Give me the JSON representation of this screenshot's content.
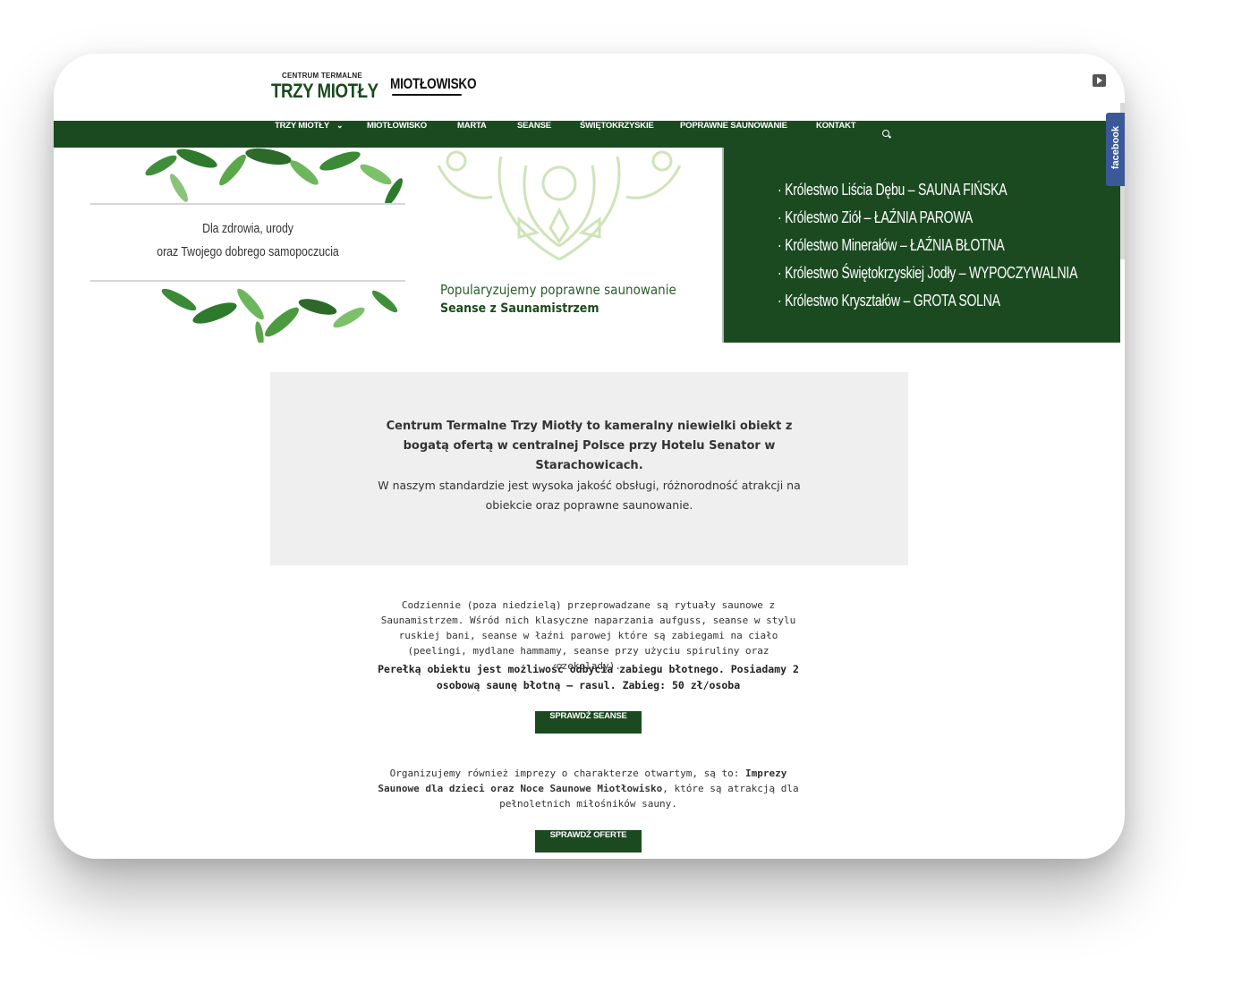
{
  "header": {
    "logo_small": "CENTRUM TERMALNE",
    "logo_big": "TRZY MIOTŁY",
    "logo_second": "MIOTŁOWISKO",
    "video_icon": "play-icon"
  },
  "nav": {
    "items": [
      "TRZY MIOTŁY",
      "MIOTŁOWISKO",
      "MARTA",
      "SEANSE",
      "ŚWIĘTOKRZYSKIE",
      "POPRAWNE SAUNOWANIE",
      "KONTAKT"
    ],
    "dropdown_icon": "chevron-down-icon",
    "search_icon": "search-icon",
    "bg_color": "#1b4a20"
  },
  "facebook_tab": {
    "label": "facebook",
    "color": "#3b5998"
  },
  "banner": {
    "card_line1": "Dla zdrowia, urody",
    "card_line2": "oraz Twojego dobrego samopoczucia",
    "tagline1": "Popularyzujemy poprawne saunowanie",
    "tagline2": "Seanse z Saunamistrzem",
    "kingdoms": [
      "· Królestwo Liścia Dębu – SAUNA FIŃSKA",
      "· Królestwo Ziół – ŁAŹNIA PAROWA",
      "· Królestwo Minerałów – ŁAŹNIA BŁOTNA",
      "· Królestwo Świętokrzyskiej Jodły – WYPOCZYWALNIA",
      "· Królestwo Kryształów – GROTA SOLNA"
    ]
  },
  "intro": {
    "bold": "Centrum Termalne Trzy Miotły to kameralny niewielki obiekt z bogatą ofertą w centralnej Polsce przy Hotelu Senator w Starachowicach.",
    "normal": "W naszym standardzie jest wysoka jakość obsługi, różnorodność atrakcji na obiekcie oraz poprawne saunowanie."
  },
  "rituals": {
    "text": "Codziennie (poza niedzielą) przeprowadzane są rytuały saunowe z Saunamistrzem. Wśród nich klasyczne naparzania aufguss, seanse w stylu ruskiej bani, seanse w łaźni parowej które są zabiegami na ciało (peelingi, mydlane hammamy, seanse przy użyciu spiruliny oraz czekolady).",
    "bold": "Perełką obiektu jest możliwość odbycia zabiegu błotnego. Posiadamy 2 osobową saunę błotną – rasul. Zabieg: 50 zł/osoba",
    "button": "SPRAWDŹ SEANSE"
  },
  "events": {
    "text_before": "Organizujemy również imprezy o charakterze otwartym, są to: ",
    "text_bold": "Imprezy Saunowe dla dzieci oraz Noce Saunowe Miotłowisko",
    "text_after": ", które są atrakcją dla pełnoletnich miłośników sauny.",
    "button": "SPRAWDŹ OFERTE"
  }
}
